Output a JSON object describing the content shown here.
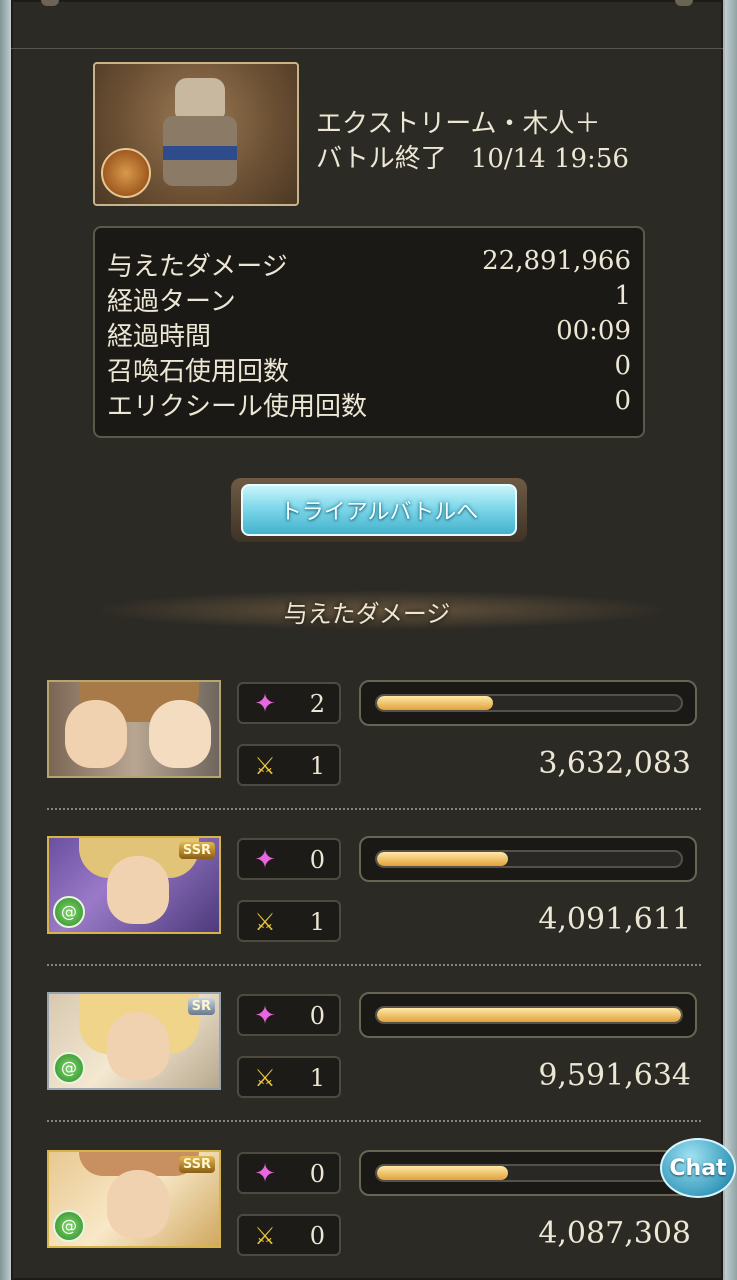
{
  "quest": {
    "title": "エクストリーム・木人＋",
    "end_label": "バトル終了",
    "end_datetime": "10/14 19:56"
  },
  "stats": [
    {
      "label": "与えたダメージ",
      "value": "22,891,966"
    },
    {
      "label": "経過ターン",
      "value": "1"
    },
    {
      "label": "経過時間",
      "value": "00:09"
    },
    {
      "label": "召喚石使用回数",
      "value": "0"
    },
    {
      "label": "エリクシール使用回数",
      "value": "0"
    }
  ],
  "trial_button": {
    "label": "トライアルバトルへ"
  },
  "section": {
    "title": "与えたダメージ"
  },
  "characters": [
    {
      "rarity": "",
      "skills": "2",
      "charge_attacks": "1",
      "damage": "3,632,083",
      "damage_fraction": 0.38,
      "element": "",
      "hair_color": "#a87a48"
    },
    {
      "rarity": "SSR",
      "skills": "0",
      "charge_attacks": "1",
      "damage": "4,091,611",
      "damage_fraction": 0.43,
      "element": "wind",
      "hair_color": "#e2c478"
    },
    {
      "rarity": "SR",
      "skills": "0",
      "charge_attacks": "1",
      "damage": "9,591,634",
      "damage_fraction": 1.0,
      "element": "wind",
      "hair_color": "#f0d48a"
    },
    {
      "rarity": "SSR",
      "skills": "0",
      "charge_attacks": "0",
      "damage": "4,087,308",
      "damage_fraction": 0.43,
      "element": "wind",
      "hair_color": "#f2eee6"
    }
  ],
  "icons": {
    "skill": "pink-star-icon",
    "charge_attack": "gold-crossed-swords-icon",
    "element": "wind-element-icon"
  },
  "chat": {
    "label": "Chat"
  }
}
